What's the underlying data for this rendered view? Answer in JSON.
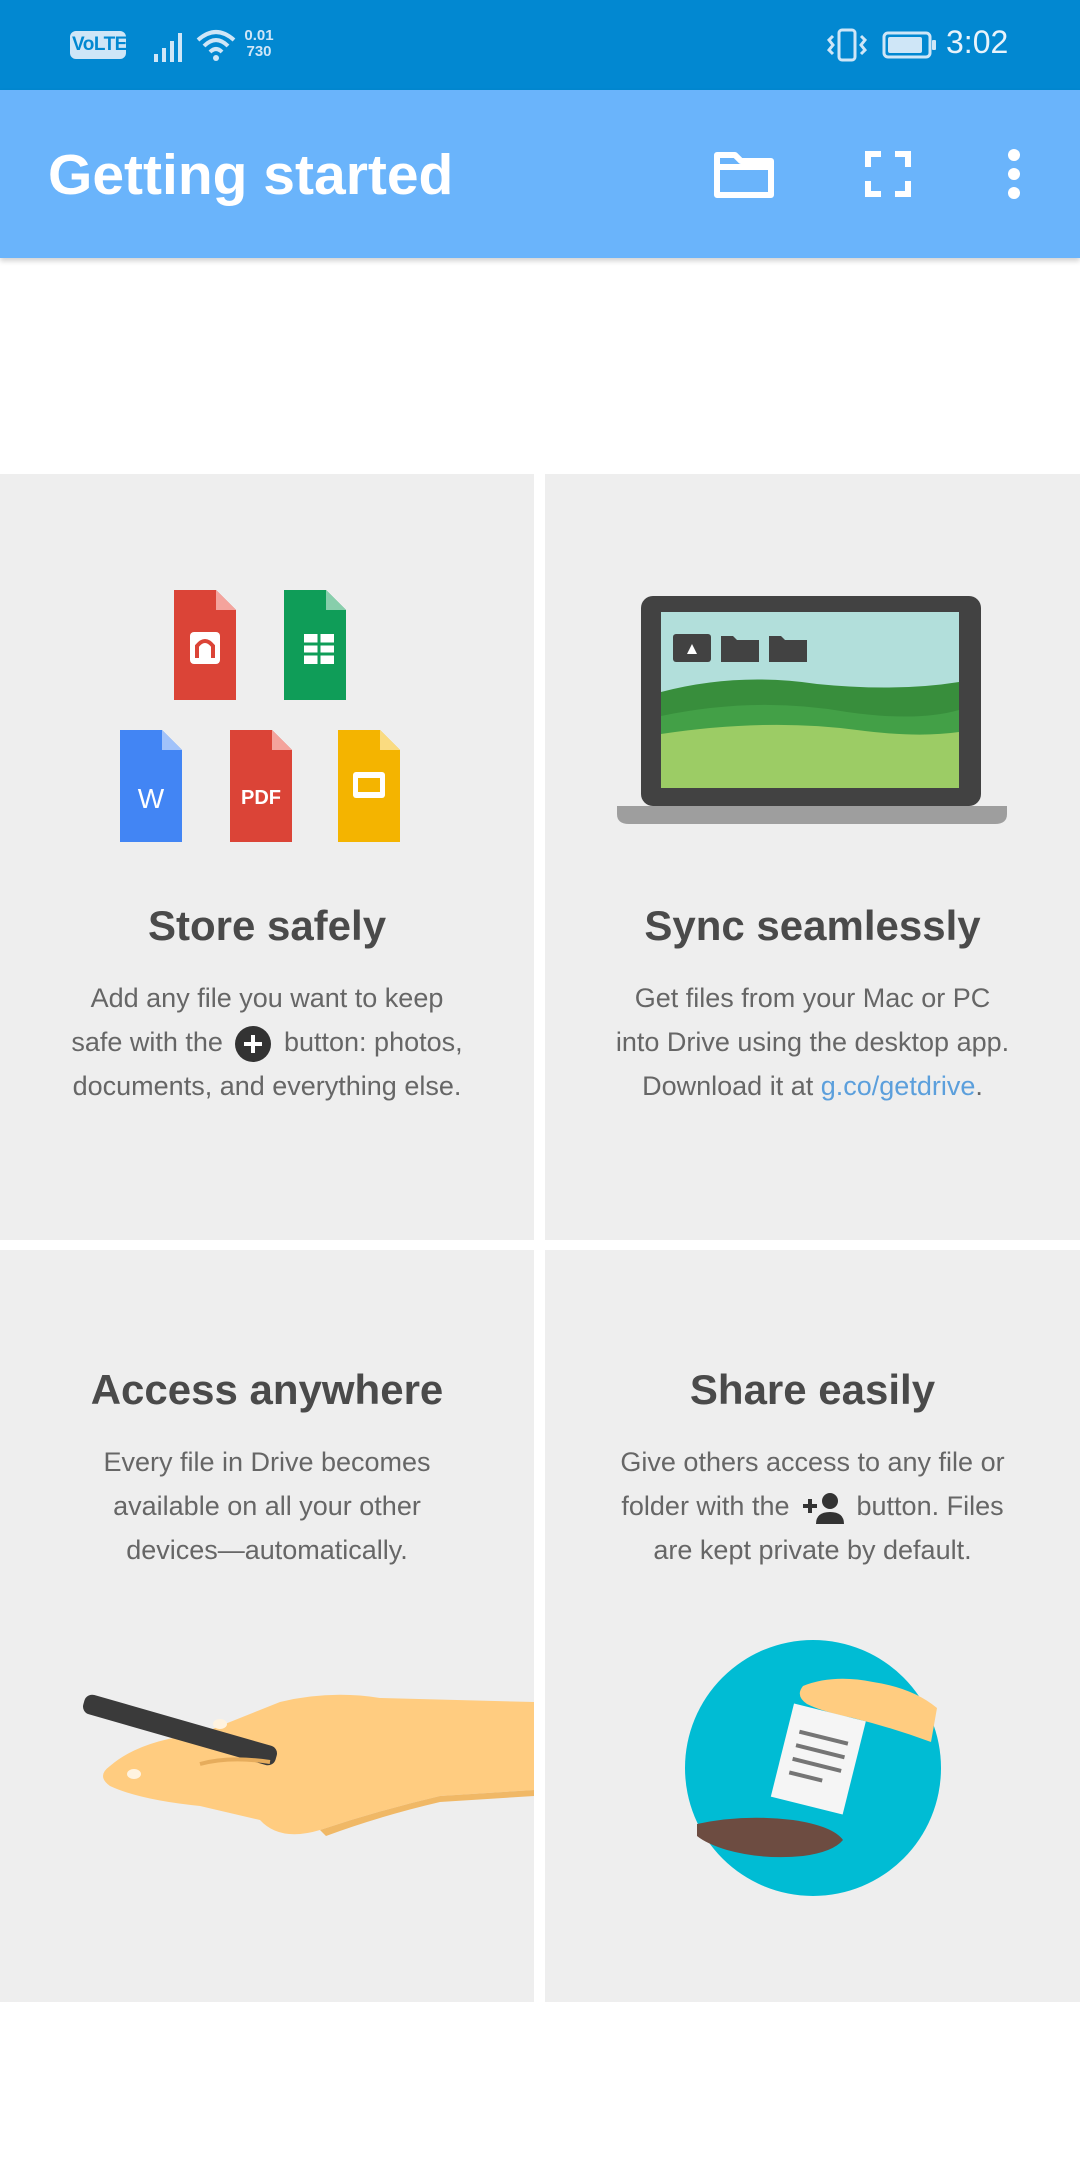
{
  "status_bar": {
    "volte": "VoLTE",
    "speed_top": "0.01",
    "speed_bottom": "730",
    "time": "3:02"
  },
  "app_bar": {
    "title": "Getting started",
    "icons": [
      "folder-icon",
      "fullscreen-icon",
      "more-vert-icon"
    ]
  },
  "cards": {
    "store": {
      "title": "Store safely",
      "line1": "Add any file you want to keep",
      "line2_pre": "safe with the",
      "line2_post": "button: photos,",
      "line3": "documents, and everything else.",
      "file_labels": [
        "W",
        "PDF"
      ]
    },
    "sync": {
      "title": "Sync seamlessly",
      "line1": "Get files from your Mac or PC",
      "line2": "into Drive using the desktop app.",
      "line3_pre": "Download it at",
      "link": "g.co/getdrive",
      "line3_post": "."
    },
    "access": {
      "title": "Access anywhere",
      "line1": "Every file in Drive becomes",
      "line2": "available on all your other",
      "line3": "devices—automatically."
    },
    "share": {
      "title": "Share easily",
      "line1": "Give others access to any file or",
      "line2_pre": "folder with the",
      "line2_post": "button. Files",
      "line3": "are kept private by default."
    }
  },
  "colors": {
    "status_bar": "#0288d1",
    "app_bar": "#6ab4fb",
    "card_bg": "#eeeeee",
    "link": "#5b9fdc"
  }
}
